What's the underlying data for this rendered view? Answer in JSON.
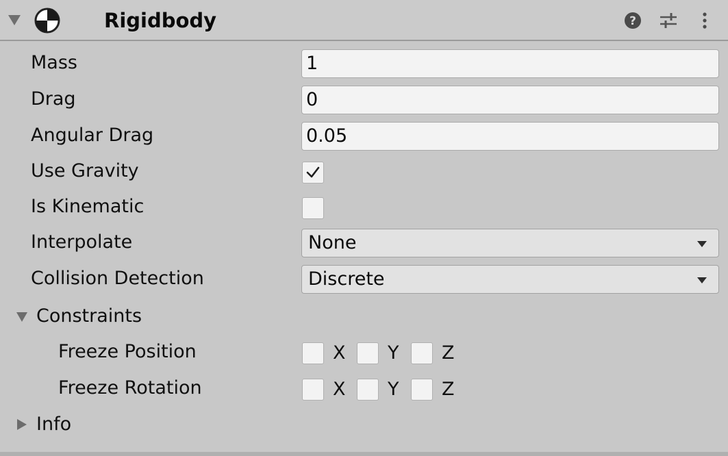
{
  "header": {
    "title": "Rigidbody",
    "icons": {
      "foldout": "triangle-down-icon",
      "component": "rigidbody-icon",
      "help": "help-icon",
      "presets": "presets-icon",
      "menu": "kebab-menu-icon"
    }
  },
  "fields": {
    "mass": {
      "label": "Mass",
      "value": "1"
    },
    "drag": {
      "label": "Drag",
      "value": "0"
    },
    "angular_drag": {
      "label": "Angular Drag",
      "value": "0.05"
    },
    "use_gravity": {
      "label": "Use Gravity",
      "checked": true
    },
    "is_kinematic": {
      "label": "Is Kinematic",
      "checked": false
    },
    "interpolate": {
      "label": "Interpolate",
      "value": "None"
    },
    "collision_detection": {
      "label": "Collision Detection",
      "value": "Discrete"
    }
  },
  "constraints": {
    "label": "Constraints",
    "freeze_position": {
      "label": "Freeze Position",
      "axes": [
        {
          "label": "X",
          "checked": false
        },
        {
          "label": "Y",
          "checked": false
        },
        {
          "label": "Z",
          "checked": false
        }
      ]
    },
    "freeze_rotation": {
      "label": "Freeze Rotation",
      "axes": [
        {
          "label": "X",
          "checked": false
        },
        {
          "label": "Y",
          "checked": false
        },
        {
          "label": "Z",
          "checked": false
        }
      ]
    }
  },
  "info": {
    "label": "Info"
  },
  "colors": {
    "panel_bg": "#c8c8c8",
    "field_bg": "#f3f3f3",
    "dropdown_bg": "#e2e2e2",
    "text": "#0a0a0a"
  }
}
